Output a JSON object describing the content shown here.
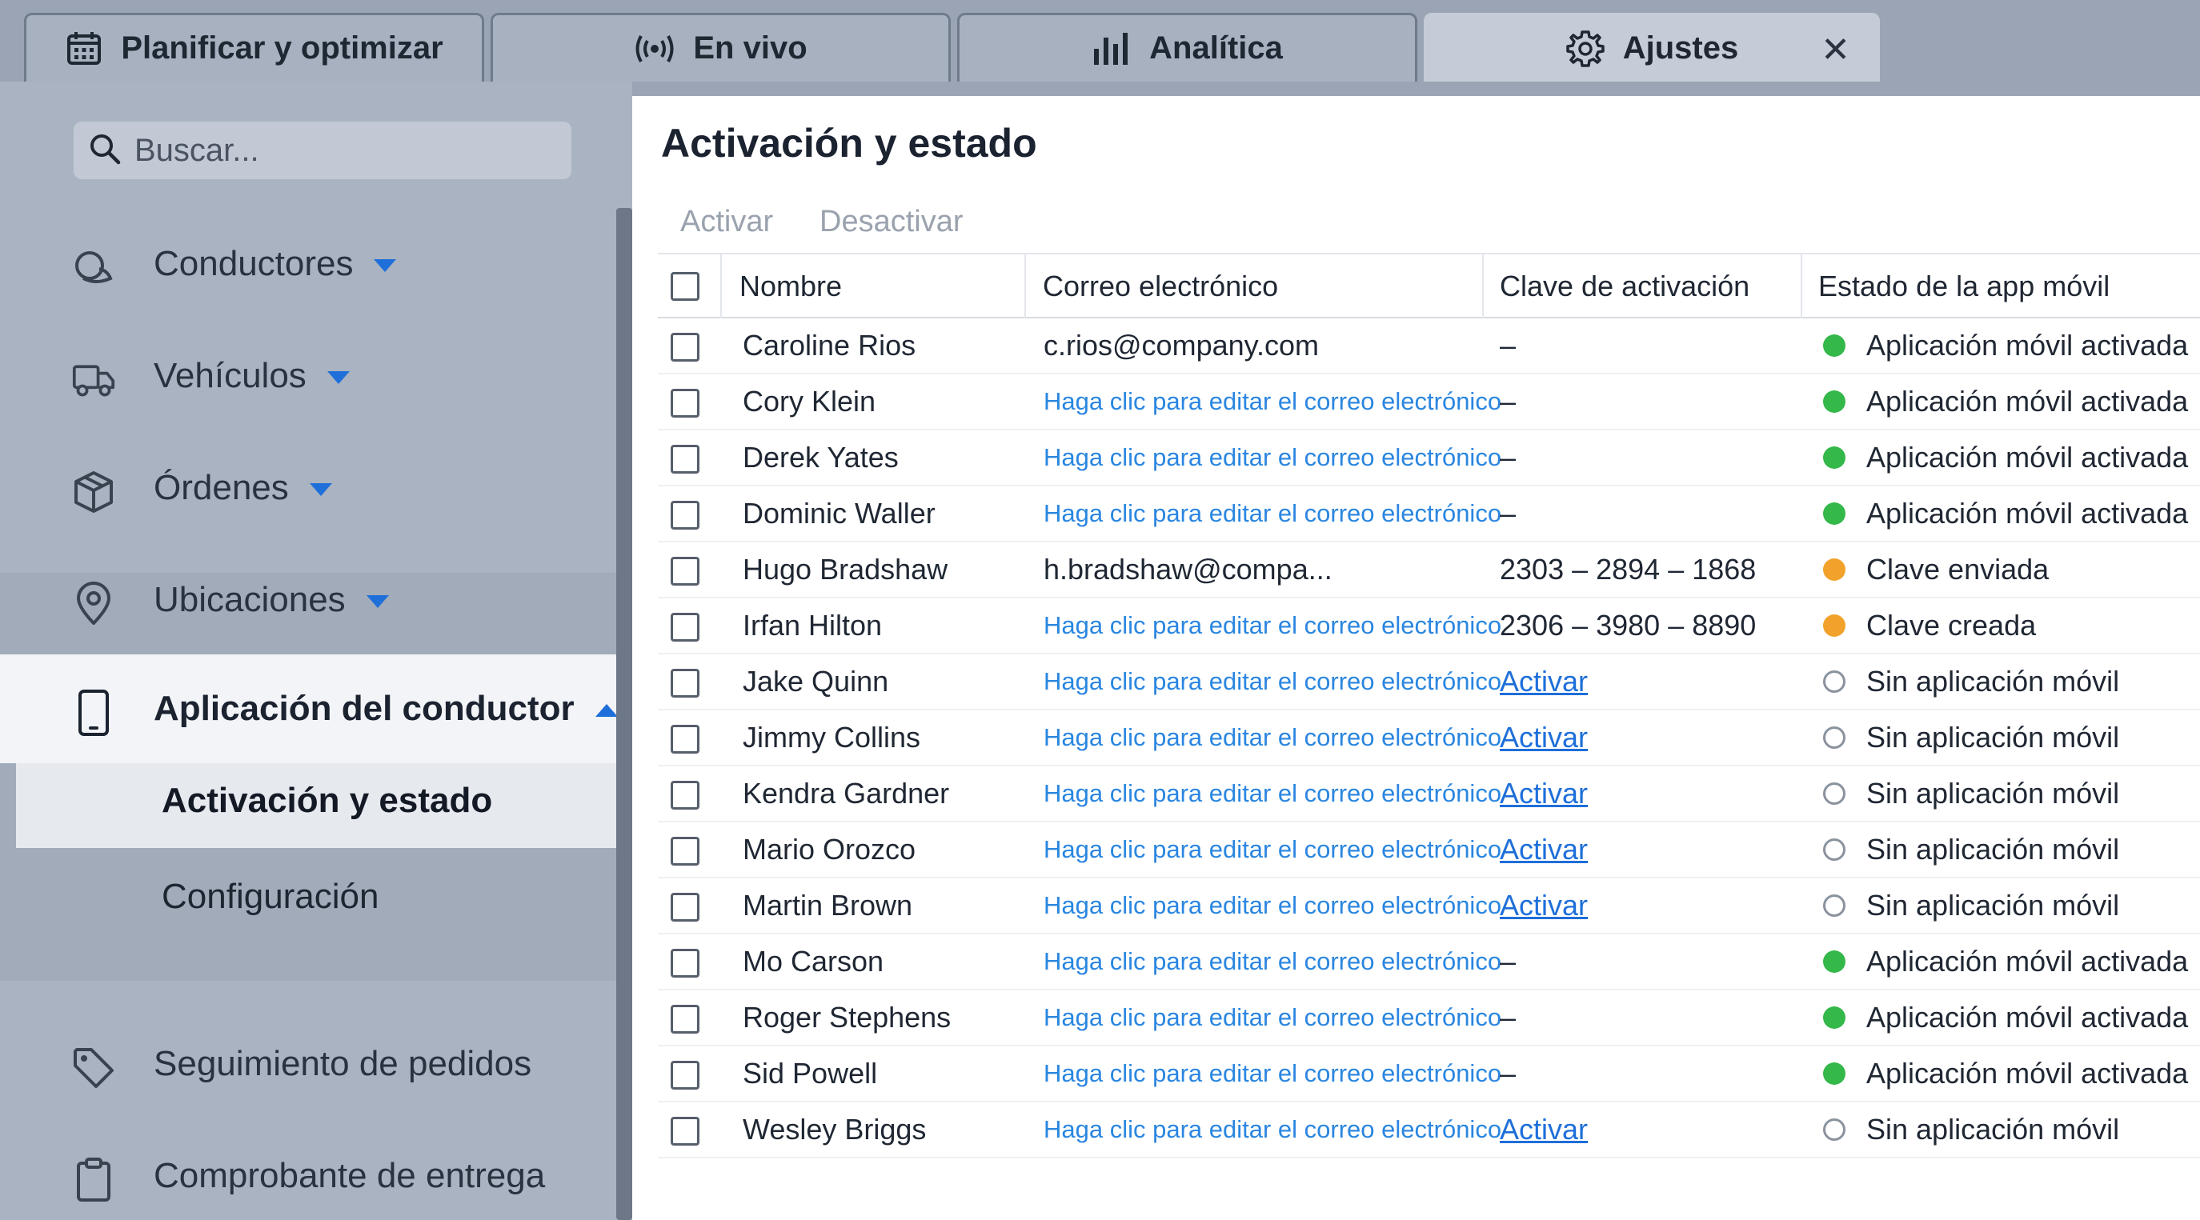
{
  "tabs": [
    {
      "label": "Planificar y optimizar",
      "icon": "calendar-icon"
    },
    {
      "label": "En vivo",
      "icon": "broadcast-icon"
    },
    {
      "label": "Analítica",
      "icon": "bar-chart-icon"
    },
    {
      "label": "Ajustes",
      "icon": "gear-icon"
    }
  ],
  "active_tab": "Ajustes",
  "sidebar": {
    "search_placeholder": "Buscar...",
    "items": [
      {
        "label": "Conductores",
        "icon": "drivers-icon",
        "expand": "collapsed"
      },
      {
        "label": "Vehículos",
        "icon": "truck-icon",
        "expand": "collapsed"
      },
      {
        "label": "Órdenes",
        "icon": "package-icon",
        "expand": "collapsed"
      },
      {
        "label": "Ubicaciones",
        "icon": "location-pin-icon",
        "expand": "collapsed"
      },
      {
        "label": "Aplicación del conductor",
        "icon": "phone-icon",
        "expand": "expanded"
      },
      {
        "label": "Seguimiento de pedidos",
        "icon": "tag-icon"
      },
      {
        "label": "Comprobante de entrega",
        "icon": "clipboard-icon"
      }
    ],
    "subitems": [
      "Activación y estado",
      "Configuración"
    ],
    "active_subitem": "Activación y estado"
  },
  "main": {
    "title": "Activación y estado",
    "toolbar": {
      "activate": "Activar",
      "deactivate": "Desactivar"
    },
    "columns": [
      "Nombre",
      "Correo electrónico",
      "Clave de activación",
      "Estado de la app móvil"
    ],
    "status_colors": {
      "activated": "#34b84a",
      "pending": "#f2a22b",
      "none": "#ffffff"
    },
    "rows": [
      {
        "name": "Caroline Rios",
        "email": "c.rios@company.com",
        "email_link": false,
        "key": "–",
        "key_link": false,
        "status": "Aplicación móvil activada",
        "status_type": "green"
      },
      {
        "name": "Cory Klein",
        "email": "Haga clic para editar el correo electrónico",
        "email_link": true,
        "key": "–",
        "key_link": false,
        "status": "Aplicación móvil activada",
        "status_type": "green"
      },
      {
        "name": "Derek Yates",
        "email": "Haga clic para editar el correo electrónico",
        "email_link": true,
        "key": "–",
        "key_link": false,
        "status": "Aplicación móvil activada",
        "status_type": "green"
      },
      {
        "name": "Dominic Waller",
        "email": "Haga clic para editar el correo electrónico",
        "email_link": true,
        "key": "–",
        "key_link": false,
        "status": "Aplicación móvil activada",
        "status_type": "green"
      },
      {
        "name": "Hugo Bradshaw",
        "email": "h.bradshaw@compa...",
        "email_link": false,
        "key": "2303 – 2894 – 1868",
        "key_link": false,
        "status": "Clave enviada",
        "status_type": "orange"
      },
      {
        "name": "Irfan Hilton",
        "email": "Haga clic para editar el correo electrónico",
        "email_link": true,
        "key": "2306 – 3980 – 8890",
        "key_link": false,
        "status": "Clave creada",
        "status_type": "orange"
      },
      {
        "name": "Jake Quinn",
        "email": "Haga clic para editar el correo electrónico",
        "email_link": true,
        "key": "Activar",
        "key_link": true,
        "status": "Sin aplicación móvil",
        "status_type": "none"
      },
      {
        "name": "Jimmy Collins",
        "email": "Haga clic para editar el correo electrónico",
        "email_link": true,
        "key": "Activar",
        "key_link": true,
        "status": "Sin aplicación móvil",
        "status_type": "none"
      },
      {
        "name": "Kendra Gardner",
        "email": "Haga clic para editar el correo electrónico",
        "email_link": true,
        "key": "Activar",
        "key_link": true,
        "status": "Sin aplicación móvil",
        "status_type": "none"
      },
      {
        "name": "Mario Orozco",
        "email": "Haga clic para editar el correo electrónico",
        "email_link": true,
        "key": "Activar",
        "key_link": true,
        "status": "Sin aplicación móvil",
        "status_type": "none"
      },
      {
        "name": "Martin Brown",
        "email": "Haga clic para editar el correo electrónico",
        "email_link": true,
        "key": "Activar",
        "key_link": true,
        "status": "Sin aplicación móvil",
        "status_type": "none"
      },
      {
        "name": "Mo Carson",
        "email": "Haga clic para editar el correo electrónico",
        "email_link": true,
        "key": "–",
        "key_link": false,
        "status": "Aplicación móvil activada",
        "status_type": "green"
      },
      {
        "name": "Roger Stephens",
        "email": "Haga clic para editar el correo electrónico",
        "email_link": true,
        "key": "–",
        "key_link": false,
        "status": "Aplicación móvil activada",
        "status_type": "green"
      },
      {
        "name": "Sid Powell",
        "email": "Haga clic para editar el correo electrónico",
        "email_link": true,
        "key": "–",
        "key_link": false,
        "status": "Aplicación móvil activada",
        "status_type": "green"
      },
      {
        "name": "Wesley Briggs",
        "email": "Haga clic para editar el correo electrónico",
        "email_link": true,
        "key": "Activar",
        "key_link": true,
        "status": "Sin aplicación móvil",
        "status_type": "none"
      }
    ]
  }
}
